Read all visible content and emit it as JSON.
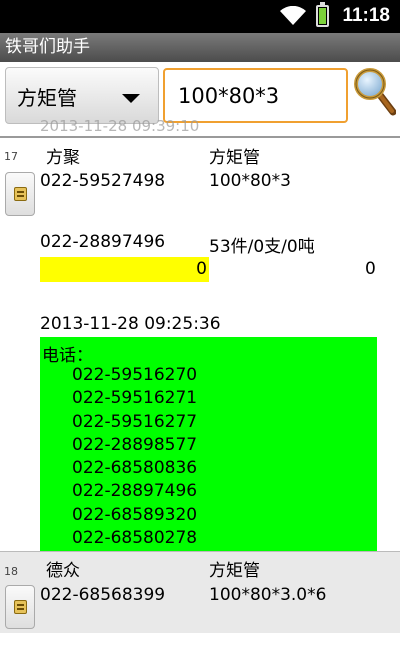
{
  "status_bar": {
    "time": "11:18",
    "wifi_icon": "wifi-icon",
    "battery_icon": "battery-charging-icon"
  },
  "app": {
    "title": "铁哥们助手"
  },
  "search": {
    "category": "方矩管",
    "query": "100*80*3",
    "search_icon": "magnifier-icon"
  },
  "cut_text": "2013-11-28 09:39:10",
  "items": [
    {
      "number": "17",
      "company": "方聚",
      "product": "方矩管",
      "phone": "022-59527498",
      "spec": "100*80*3",
      "phone2": "022-28897496",
      "stock": "53件/0支/0吨",
      "bar_value": "0",
      "value_right": "0",
      "timestamp": "2013-11-28  09:25:36",
      "phones_label": "电话：",
      "phones": [
        "022-59516270",
        "022-59516271",
        "022-59516277",
        "022-28898577",
        "022-68580836",
        "022-28897496",
        "022-68589320",
        "022-68580278"
      ],
      "highlight_color": "#00ff00"
    },
    {
      "number": "18",
      "company": "德众",
      "product": "方矩管",
      "phone": "022-68568399",
      "spec": "100*80*3.0*6"
    }
  ]
}
